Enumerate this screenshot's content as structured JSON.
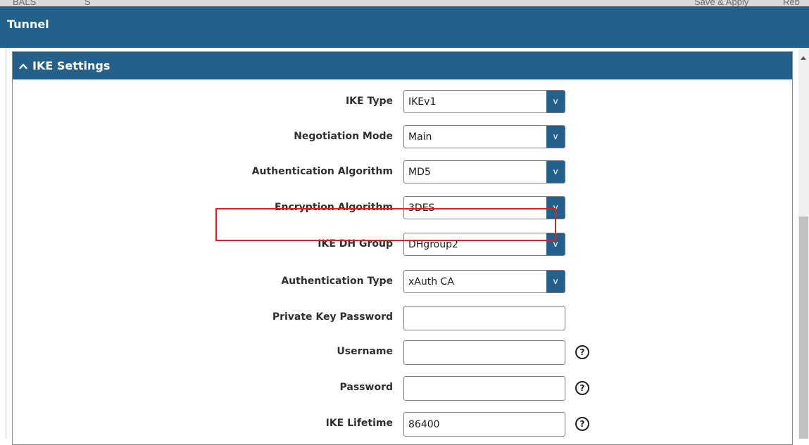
{
  "header_fragments": [
    "BALS",
    "S",
    "Save & Apply",
    "Reb"
  ],
  "window": {
    "title": "Tunnel"
  },
  "section": {
    "title": "IKE Settings",
    "chevron": "chevron-up-icon"
  },
  "fields": {
    "ike_type": {
      "label": "IKE Type",
      "value": "IKEv1"
    },
    "negotiation_mode": {
      "label": "Negotiation Mode",
      "value": "Main"
    },
    "auth_algorithm": {
      "label": "Authentication Algorithm",
      "value": "MD5"
    },
    "enc_algorithm": {
      "label": "Encryption Algorithm",
      "value": "3DES"
    },
    "dh_group": {
      "label": "IKE DH Group",
      "value": "DHgroup2"
    },
    "auth_type": {
      "label": "Authentication Type",
      "value": "xAuth CA"
    },
    "private_key_password": {
      "label": "Private Key Password",
      "value": ""
    },
    "username": {
      "label": "Username",
      "value": ""
    },
    "password": {
      "label": "Password",
      "value": ""
    },
    "ike_lifetime": {
      "label": "IKE Lifetime",
      "value": "86400"
    }
  },
  "icons": {
    "dropdown": "v",
    "help": "?"
  },
  "colors": {
    "accent": "#23608a",
    "highlight": "#e0201c"
  }
}
